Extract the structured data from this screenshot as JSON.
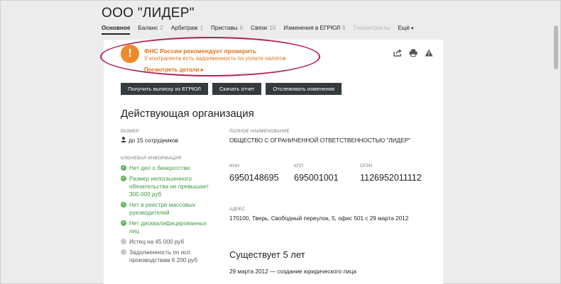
{
  "company": {
    "title": "ООО \"ЛИДЕР\""
  },
  "tabs": [
    {
      "label": "Основное",
      "count": ""
    },
    {
      "label": "Баланс",
      "count": "2"
    },
    {
      "label": "Арбитраж",
      "count": "1"
    },
    {
      "label": "Приставы",
      "count": "6"
    },
    {
      "label": "Связи",
      "count": "10"
    },
    {
      "label": "Изменения в ЕГРЮЛ",
      "count": "5"
    },
    {
      "label": "Госконтракты",
      "count": ""
    },
    {
      "label": "Ещё",
      "count": ""
    }
  ],
  "alert": {
    "icon": "!",
    "title": "ФНС России рекомендует проверить",
    "subtitle": "У контрагента есть задолженность по уплате налогов",
    "link": "Посмотреть детали ▸"
  },
  "top_icons": [
    "share-icon",
    "print-icon",
    "warning-icon"
  ],
  "buttons": {
    "extract": "Получить выписку из ЕГРЮЛ",
    "download": "Скачать отчет",
    "track": "Отслеживать изменения"
  },
  "status_title": "Действующая организация",
  "size": {
    "label": "Размер",
    "value": "до 15 сотрудников"
  },
  "key_info": {
    "label": "Ключевая информация",
    "items": [
      {
        "text": "Нет дел о банкротстве",
        "status": "ok"
      },
      {
        "text": "Размер непогашенного обязательства не превышает 300 000 руб",
        "status": "ok"
      },
      {
        "text": "Нет в реестре массовых руководителей",
        "status": "ok"
      },
      {
        "text": "Нет дисквалифицированных лиц",
        "status": "ok"
      },
      {
        "text": "Истец на 45 000 руб",
        "status": "neutral"
      },
      {
        "text": "Задолженность по исп. производствам 6 200 руб",
        "status": "neutral"
      }
    ]
  },
  "full_name": {
    "label": "Полное наименование",
    "value": "ОБЩЕСТВО С ОГРАНИЧЕННОЙ ОТВЕТСТВЕННОСТЬЮ \"ЛИДЕР\""
  },
  "inn": {
    "label": "ИНН",
    "value": "6950148695"
  },
  "kpp": {
    "label": "КПП",
    "value": "695001001"
  },
  "ogrn": {
    "label": "ОГРН",
    "value": "1126952011112"
  },
  "address": {
    "label": "Адрес",
    "value": "170100, Тверь, Свободный переулок, 5, офис 501 с 29 марта 2012"
  },
  "existence": {
    "title": "Существует 5 лет",
    "text": "29 марта 2012 — создание юридического лица"
  },
  "colors": {
    "accent_orange": "#e07318",
    "ok_green": "#63b35f",
    "button_dark": "#343b3f",
    "highlight_ellipse": "#b1224d"
  }
}
